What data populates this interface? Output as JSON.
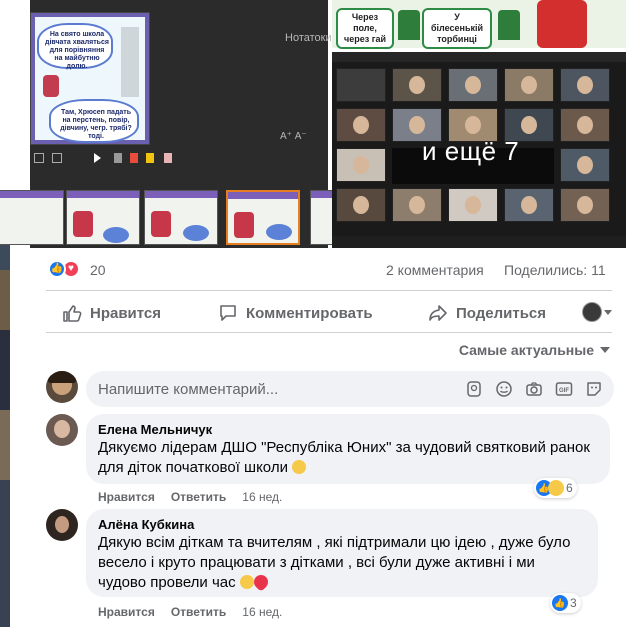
{
  "media": {
    "slide_text_top": "На свято школа дівчата хваляться для порівняння на майбутню долю.",
    "slide_text_cloud": "Там, Хрюсеп падать на перстень, повір, дівчину, чегр. трябі? тоді.",
    "notes_label": "Нотатоки",
    "az_label": "А⁺ А⁻",
    "tag_left": "Через поле, через гай",
    "tag_right": "У білесенькій торбинці",
    "more_participants": "и ещё 7"
  },
  "summary": {
    "reaction_count": "20",
    "comments": "2 комментария",
    "shares": "Поделились: 11"
  },
  "actions": {
    "like": "Нравится",
    "comment": "Комментировать",
    "share": "Поделиться"
  },
  "sort": {
    "label": "Самые актуальные"
  },
  "composer": {
    "placeholder": "Напишите комментарий..."
  },
  "comments": [
    {
      "author": "Елена Мельничук",
      "text": "Дякуємо лідерам ДШО \"Республіка Юних\" за чудовий святковий ранок для діток початкової школи",
      "like": "Нравится",
      "reply": "Ответить",
      "time": "16 нед.",
      "reactions": "6"
    },
    {
      "author": "Алёна Кубкина",
      "text": "Дякую всім діткам та вчителям , які підтримали цю ідею , дуже було весело і круто працювати з дітками , всі були дуже активні і ми чудово провели час",
      "like": "Нравится",
      "reply": "Ответить",
      "time": "16 нед.",
      "reactions": "3"
    }
  ],
  "colors": {
    "fb_blue": "#1877f2",
    "love_red": "#f33e58",
    "text_secondary": "#65676b",
    "bubble_bg": "#f0f2f5"
  }
}
